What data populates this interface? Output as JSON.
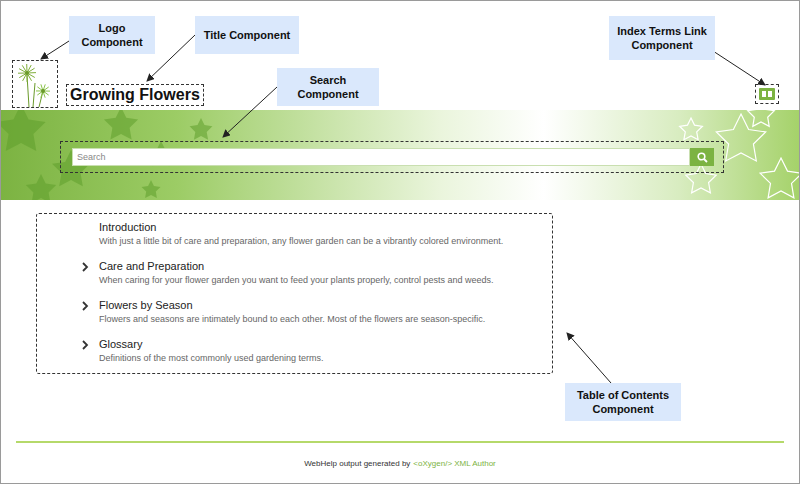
{
  "callouts": {
    "logo": "Logo Component",
    "title": "Title Component",
    "search": "Search Component",
    "index_terms": "Index Terms Link Component",
    "toc": "Table of Contents Component"
  },
  "site": {
    "title": "Growing Flowers"
  },
  "search": {
    "placeholder": "Search"
  },
  "toc": [
    {
      "title": "Introduction",
      "description": "With just a little bit of care and preparation, any flower garden can be a vibrantly colored environment.",
      "expandable": false
    },
    {
      "title": "Care and Preparation",
      "description": "When caring for your flower garden you want to feed your plants properly, control pests and weeds.",
      "expandable": true
    },
    {
      "title": "Flowers by Season",
      "description": "Flowers and seasons are intimately bound to each other. Most of the flowers are season-specific.",
      "expandable": true
    },
    {
      "title": "Glossary",
      "description": "Definitions of the most commonly used gardening terms.",
      "expandable": true
    }
  ],
  "footer": {
    "text": "WebHelp output generated by",
    "link": "<oXygen/> XML Author"
  }
}
